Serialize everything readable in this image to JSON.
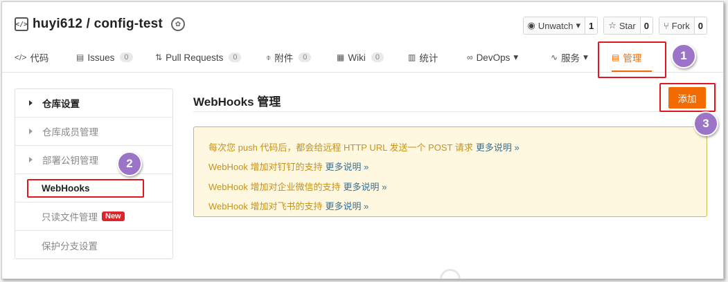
{
  "repo": {
    "owner_repo": "huyi612 / config-test",
    "icon_name": "code-brackets-icon",
    "badge_icon_name": "rosette-badge-icon"
  },
  "actions": [
    {
      "icon": "eye-icon",
      "label": "Unwatch",
      "has_caret": true,
      "count": "1"
    },
    {
      "icon": "star-icon",
      "label": "Star",
      "has_caret": false,
      "count": "0"
    },
    {
      "icon": "fork-icon",
      "label": "Fork",
      "has_caret": false,
      "count": "0"
    }
  ],
  "tabs": [
    {
      "icon": "code-icon",
      "label": "代码",
      "count": null
    },
    {
      "icon": "issues-icon",
      "label": "Issues",
      "count": "0"
    },
    {
      "icon": "pull-request-icon",
      "label": "Pull Requests",
      "count": "0"
    },
    {
      "icon": "attachment-icon",
      "label": "附件",
      "count": "0"
    },
    {
      "icon": "wiki-icon",
      "label": "Wiki",
      "count": "0"
    },
    {
      "icon": "stats-icon",
      "label": "统计",
      "count": null
    },
    {
      "icon": "devops-icon",
      "label": "DevOps",
      "count": null,
      "caret": true
    },
    {
      "icon": "service-icon",
      "label": "服务",
      "count": null,
      "caret": true
    },
    {
      "icon": "manage-icon",
      "label": "管理",
      "count": null,
      "active": true
    }
  ],
  "sidebar": {
    "items": [
      {
        "label": "仓库设置",
        "style": "strong",
        "caret": true
      },
      {
        "label": "仓库成员管理",
        "style": "muted",
        "caret": true
      },
      {
        "label": "部署公钥管理",
        "style": "muted",
        "caret": true
      },
      {
        "label": "WebHooks",
        "style": "selected",
        "caret": false
      },
      {
        "label": "只读文件管理",
        "style": "muted",
        "caret": false,
        "tag": "New"
      },
      {
        "label": "保护分支设置",
        "style": "muted",
        "caret": false
      }
    ]
  },
  "main": {
    "title": "WebHooks 管理",
    "add_button": "添加",
    "notice_lines": [
      {
        "text": "每次您 push 代码后，都会给远程 HTTP URL 发送一个 POST 请求",
        "more": "更多说明 »"
      },
      {
        "text": "WebHook 增加对钉钉的支持",
        "more": "更多说明 »"
      },
      {
        "text": "WebHook 增加对企业微信的支持",
        "more": "更多说明 »"
      },
      {
        "text": "WebHook 增加对飞书的支持",
        "more": "更多说明 »"
      }
    ]
  },
  "annotations": {
    "badges": [
      "1",
      "2",
      "3"
    ],
    "badge_color": "#9c74c7",
    "highlight_color": "#e1161f"
  },
  "colors": {
    "accent": "#f26b00",
    "notice_text": "#c7911a",
    "link": "#3a6e8f"
  }
}
